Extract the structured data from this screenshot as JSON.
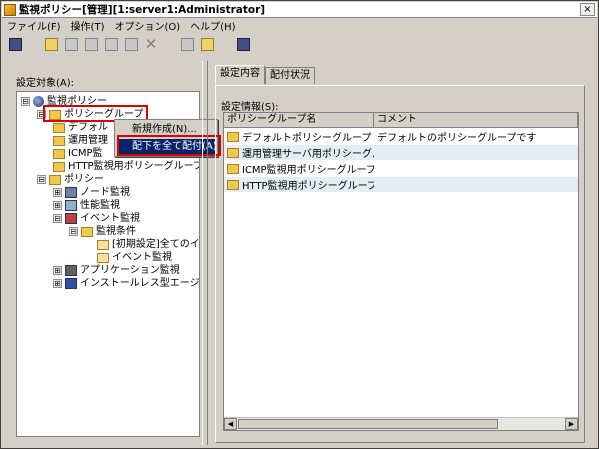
{
  "window": {
    "title": "監視ポリシー[管理][1:server1:Administrator]",
    "close_glyph": "×"
  },
  "menubar": {
    "items": [
      "ファイル(F)",
      "操作(T)",
      "オプション(O)",
      "ヘルプ(H)"
    ]
  },
  "left": {
    "label": "設定対象(A):",
    "tree": [
      {
        "text": "監視ポリシー",
        "expander": "⊟",
        "icon": "globe-icon"
      },
      {
        "text": "ポリシーグループ",
        "expander": "⊟",
        "icon": "folder-icon"
      },
      {
        "text": "デフォル",
        "icon": "folder-icon"
      },
      {
        "text": "運用管理",
        "icon": "folder-icon"
      },
      {
        "text": "ICMP監",
        "icon": "folder-icon"
      },
      {
        "text": "HTTP監視用ポリシーグループ",
        "icon": "folder-icon"
      },
      {
        "text": "ポリシー",
        "expander": "⊟",
        "icon": "folder-icon"
      },
      {
        "text": "ノード監視",
        "expander": "⊞",
        "icon": "node-icon"
      },
      {
        "text": "性能監視",
        "expander": "⊞",
        "icon": "chart-icon"
      },
      {
        "text": "イベント監視",
        "expander": "⊟",
        "icon": "event-icon"
      },
      {
        "text": "監視条件",
        "expander": "⊟",
        "icon": "folder-icon"
      },
      {
        "text": "[初期設定]全てのイ",
        "icon": "doc-icon"
      },
      {
        "text": "イベント監視",
        "icon": "doc-icon"
      },
      {
        "text": "アプリケーション監視",
        "expander": "⊞",
        "icon": "app-icon"
      },
      {
        "text": "インストールレス型エージ",
        "expander": "⊞",
        "icon": "agentless-icon"
      }
    ]
  },
  "context_menu": {
    "items": [
      "新規作成(N)...",
      "配下を全て配付(A)"
    ]
  },
  "right": {
    "tabs": [
      "設定内容",
      "配付状況"
    ],
    "label": "設定情報(S):",
    "columns": [
      "ポリシーグループ名",
      "コメント"
    ],
    "rows": [
      {
        "name": "デフォルトポリシーグループ",
        "comment": "デフォルトのポリシーグループです"
      },
      {
        "name": "運用管理サーバ用ポリシーグ...",
        "comment": ""
      },
      {
        "name": "ICMP監視用ポリシーグループ",
        "comment": ""
      },
      {
        "name": "HTTP監視用ポリシーグループ",
        "comment": ""
      }
    ]
  },
  "toolbar": {
    "icons": [
      "property-icon",
      "new-folder-icon",
      "new-policy-icon",
      "edit-icon",
      "copy-icon",
      "paste-icon",
      "delete-icon",
      "import-icon",
      "export-icon",
      "deploy-icon"
    ]
  },
  "colors": {
    "highlight": "#e00000",
    "selection": "#0a246a",
    "face": "#d4d0c8"
  }
}
